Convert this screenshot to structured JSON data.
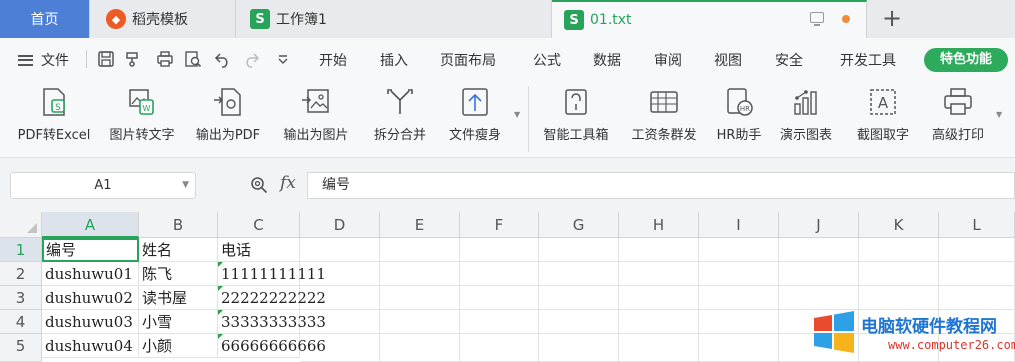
{
  "tabs": {
    "home": "首页",
    "daoke": "稻壳模板",
    "book": "工作簿1",
    "active": "01.txt",
    "s_glyph": "S"
  },
  "menu": {
    "file": "文件",
    "items": [
      "开始",
      "插入",
      "页面布局",
      "公式",
      "数据",
      "审阅",
      "视图",
      "安全",
      "开发工具"
    ],
    "special": "特色功能"
  },
  "ribbon": {
    "items": [
      "PDF转Excel",
      "图片转文字",
      "输出为PDF",
      "输出为图片",
      "拆分合并",
      "文件瘦身",
      "智能工具箱",
      "工资条群发",
      "HR助手",
      "演示图表",
      "截图取字",
      "高级打印"
    ]
  },
  "formula_bar": {
    "name_box": "A1",
    "fx": "fx",
    "content": "编号"
  },
  "grid": {
    "columns": [
      "A",
      "B",
      "C",
      "D",
      "E",
      "F",
      "G",
      "H",
      "I",
      "J",
      "K",
      "L"
    ],
    "rows": [
      {
        "num": "1",
        "a": "编号",
        "b": "姓名",
        "c": "电话"
      },
      {
        "num": "2",
        "a": "dushuwu01",
        "b": "陈飞",
        "c": "11111111111"
      },
      {
        "num": "3",
        "a": "dushuwu02",
        "b": "读书屋",
        "c": "22222222222"
      },
      {
        "num": "4",
        "a": "dushuwu03",
        "b": "小雪",
        "c": "33333333333"
      },
      {
        "num": "5",
        "a": "dushuwu04",
        "b": "小颜",
        "c": "66666666666"
      }
    ]
  },
  "watermark": {
    "title": "电脑软硬件教程网",
    "url": "www.computer26.com"
  },
  "colors": {
    "accent_green": "#27a35a",
    "home_tab": "#4e7fd6",
    "special_button": "#2eaa5c"
  }
}
